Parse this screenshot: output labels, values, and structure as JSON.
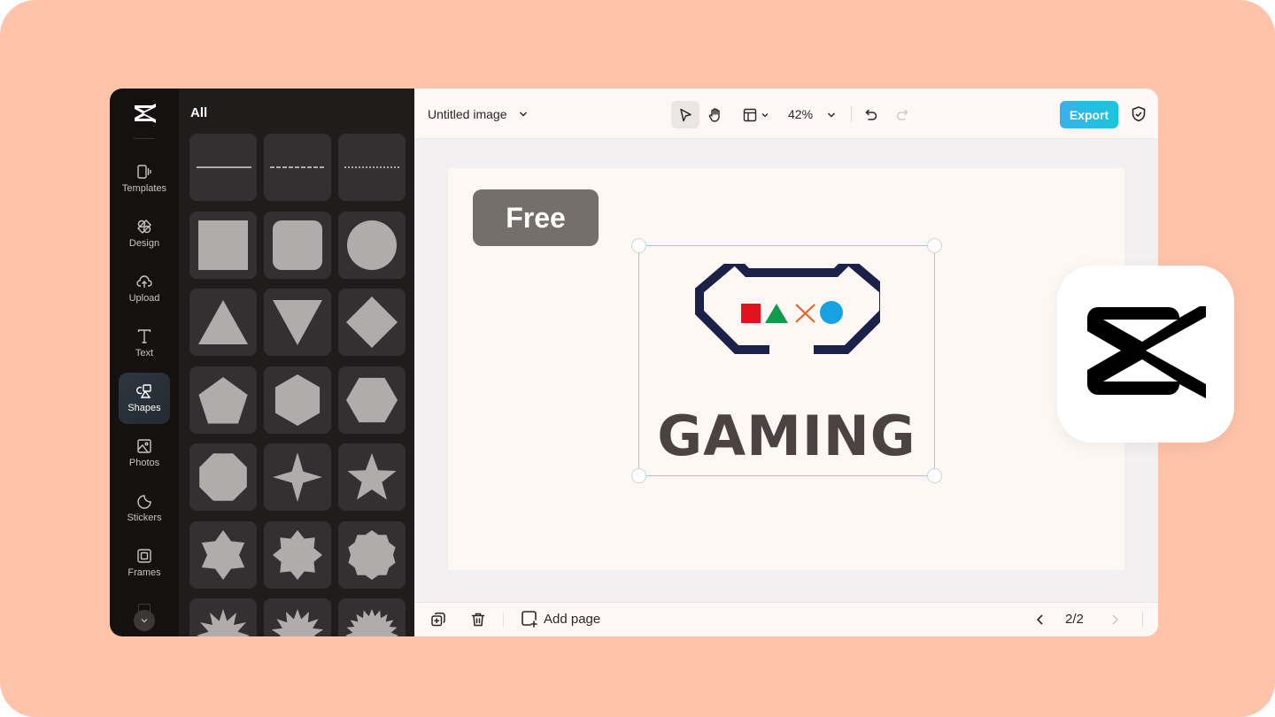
{
  "app": {
    "name": "CapCut",
    "logo_icon": "capcut-logo-icon"
  },
  "rail": {
    "items": [
      {
        "label": "Templates",
        "icon": "templates-icon",
        "active": false
      },
      {
        "label": "Design",
        "icon": "design-icon",
        "active": false
      },
      {
        "label": "Upload",
        "icon": "upload-cloud-icon",
        "active": false
      },
      {
        "label": "Text",
        "icon": "text-icon",
        "active": false
      },
      {
        "label": "Shapes",
        "icon": "shapes-icon",
        "active": true
      },
      {
        "label": "Photos",
        "icon": "photo-icon",
        "active": false
      },
      {
        "label": "Stickers",
        "icon": "sticker-icon",
        "active": false
      },
      {
        "label": "Frames",
        "icon": "frame-icon",
        "active": false
      }
    ],
    "more_icon": "chevron-down-icon"
  },
  "panel": {
    "title": "All",
    "shapes": [
      "solid-line",
      "dashed-line",
      "dotted-line",
      "square",
      "rounded-square",
      "circle",
      "triangle",
      "inverted-triangle",
      "diamond",
      "pentagon",
      "hexagon-vertical",
      "hexagon-horizontal",
      "octagon",
      "four-point-star",
      "five-point-star",
      "six-point-star",
      "eight-point-star",
      "ten-point-star",
      "burst-12",
      "burst-14",
      "burst-20"
    ],
    "shape_color": "#b0acab"
  },
  "topbar": {
    "doc_title": "Untitled image",
    "zoom": "42%",
    "export_label": "Export",
    "tools": [
      "select-pointer-icon",
      "hand-pan-icon",
      "layout-icon",
      "undo-icon",
      "redo-icon"
    ]
  },
  "canvas": {
    "badge": "Free",
    "logo_text": "GAMING",
    "logo_colors": {
      "outline": "#1b2148",
      "square": "#e3121f",
      "triangle": "#139a4c",
      "cross": "#e2652a",
      "circle": "#16a2e3"
    },
    "selection_color": "#6fdcef"
  },
  "bottombar": {
    "add_page_label": "Add page",
    "page_indicator": "2/2"
  },
  "colors": {
    "background": "#fec3a9",
    "accent": "#18c6dc"
  }
}
